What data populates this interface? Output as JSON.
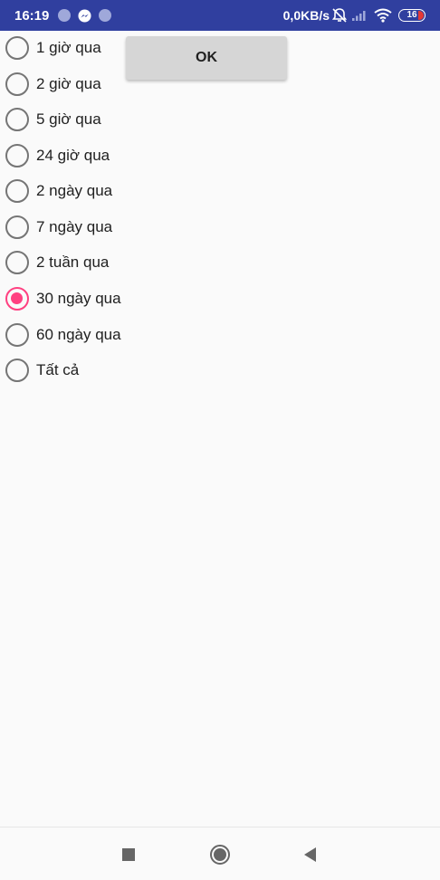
{
  "status_bar": {
    "time": "16:19",
    "network_speed": "0,0KB/s",
    "battery_level": "16",
    "icons": [
      "notification-dot-icon",
      "messenger-icon",
      "notification-dot-icon",
      "alarm-off-icon",
      "signal-icon",
      "wifi-icon",
      "battery-icon"
    ]
  },
  "time_range": {
    "options": [
      {
        "label": "1 giờ qua",
        "checked": false
      },
      {
        "label": "2 giờ qua",
        "checked": false
      },
      {
        "label": "5 giờ qua",
        "checked": false
      },
      {
        "label": "24 giờ qua",
        "checked": false
      },
      {
        "label": "2 ngày qua",
        "checked": false
      },
      {
        "label": "7 ngày qua",
        "checked": false
      },
      {
        "label": "2 tuần qua",
        "checked": false
      },
      {
        "label": "30 ngày qua",
        "checked": true
      },
      {
        "label": "60 ngày qua",
        "checked": false
      },
      {
        "label": "Tất cả",
        "checked": false
      }
    ]
  },
  "ok_button": {
    "label": "OK"
  },
  "colors": {
    "status_bar": "#303f9f",
    "radio_checked": "#ff4081",
    "radio_unchecked": "#757575",
    "button_bg": "#d6d6d6",
    "background": "#fafafa"
  },
  "nav_bar": {
    "icons": [
      "recents-square-icon",
      "home-circle-icon",
      "back-triangle-icon"
    ]
  }
}
